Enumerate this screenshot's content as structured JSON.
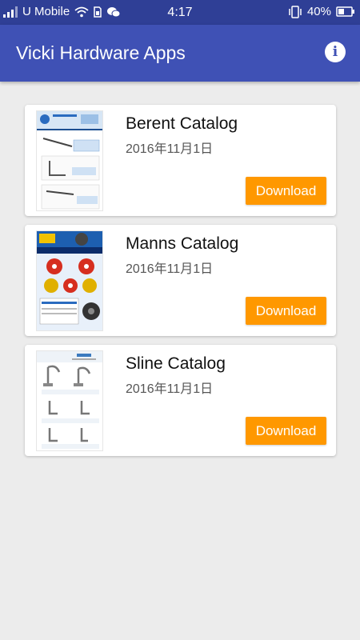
{
  "status": {
    "carrier": "U Mobile",
    "time": "4:17",
    "battery": "40%",
    "icons": [
      "signal-icon",
      "wifi-icon",
      "sim-icon",
      "wechat-icon",
      "vibrate-icon",
      "battery-icon"
    ]
  },
  "appbar": {
    "title": "Vicki Hardware Apps",
    "info_icon": "info-icon"
  },
  "colors": {
    "status_bar": "#2f3f96",
    "app_bar": "#3f51b5",
    "background": "#ececec",
    "download_button": "#ff9800"
  },
  "catalogs": [
    {
      "name": "Berent Catalog",
      "date": "2016年11月1日",
      "button": "Download"
    },
    {
      "name": "Manns Catalog",
      "date": "2016年11月1日",
      "button": "Download"
    },
    {
      "name": "Sline Catalog",
      "date": "2016年11月1日",
      "button": "Download"
    }
  ]
}
